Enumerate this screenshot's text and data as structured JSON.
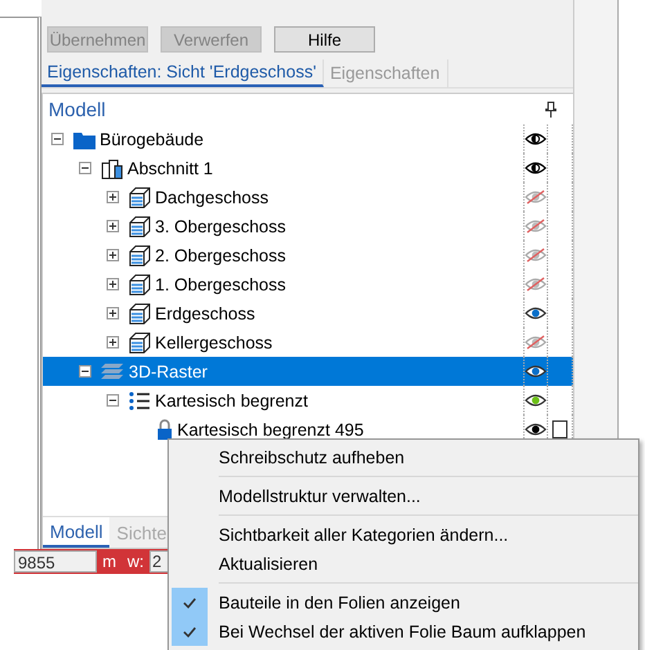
{
  "toolbar": {
    "buttons": [
      {
        "label": "Übernehmen",
        "disabled": true
      },
      {
        "label": "Verwerfen",
        "disabled": true
      },
      {
        "label": "Hilfe",
        "disabled": false
      }
    ]
  },
  "tabs": [
    {
      "label": "Eigenschaften: Sicht 'Erdgeschoss'",
      "selected": true
    },
    {
      "label": "Eigenschaften",
      "selected": false
    }
  ],
  "tree": {
    "title": "Modell",
    "nodes": [
      {
        "label": "Bürogebäude",
        "kind": "folder",
        "eye": {
          "partial": true,
          "hidden": false,
          "color": "#000000"
        },
        "selected": false,
        "expanded": true,
        "children": [
          {
            "label": "Abschnitt 1",
            "kind": "building",
            "eye": {
              "partial": true,
              "hidden": false,
              "color": "#000000"
            },
            "selected": false,
            "expanded": true,
            "children": [
              {
                "label": "Dachgeschoss",
                "kind": "floor",
                "eye": {
                  "partial": false,
                  "hidden": true,
                  "color": "#bbbbbb"
                },
                "selected": false,
                "expanded": false
              },
              {
                "label": "3. Obergeschoss",
                "kind": "floor",
                "eye": {
                  "partial": false,
                  "hidden": true,
                  "color": "#bbbbbb"
                },
                "selected": false,
                "expanded": false
              },
              {
                "label": "2. Obergeschoss",
                "kind": "floor",
                "eye": {
                  "partial": false,
                  "hidden": true,
                  "color": "#bbbbbb"
                },
                "selected": false,
                "expanded": false
              },
              {
                "label": "1. Obergeschoss",
                "kind": "floor",
                "eye": {
                  "partial": false,
                  "hidden": true,
                  "color": "#bbbbbb"
                },
                "selected": false,
                "expanded": false
              },
              {
                "label": "Erdgeschoss",
                "kind": "floor",
                "eye": {
                  "partial": false,
                  "hidden": false,
                  "color": "#0a6fc9"
                },
                "selected": false,
                "expanded": false
              },
              {
                "label": "Kellergeschoss",
                "kind": "floor",
                "eye": {
                  "partial": false,
                  "hidden": true,
                  "color": "#bbbbbb"
                },
                "selected": false,
                "expanded": false
              }
            ]
          },
          {
            "label": "3D-Raster",
            "kind": "grid",
            "eye": {
              "partial": false,
              "hidden": false,
              "color": "#0a6fc9"
            },
            "selected": true,
            "expanded": true,
            "children": [
              {
                "label": "Kartesisch begrenzt",
                "kind": "list",
                "eye": {
                  "partial": false,
                  "hidden": false,
                  "color": "#6cc017"
                },
                "selected": false,
                "expanded": true,
                "children": [
                  {
                    "label": "Kartesisch begrenzt 495",
                    "kind": "lock",
                    "eye": {
                      "partial": false,
                      "hidden": false,
                      "color": "#000000"
                    },
                    "selected": false,
                    "box": {
                      "checked": false
                    }
                  }
                ]
              }
            ]
          }
        ]
      }
    ]
  },
  "bottom_tabs": [
    {
      "label": "Modell",
      "selected": true
    },
    {
      "label": "Sichte",
      "selected": false
    }
  ],
  "status_bar": {
    "field_1": "9855",
    "unit": "m",
    "label": "w:",
    "field_2": "2"
  },
  "context_menu": {
    "items": [
      {
        "kind": "item",
        "label": "Schreibschutz aufheben",
        "checked": false
      },
      {
        "kind": "separator"
      },
      {
        "kind": "item",
        "label": "Modellstruktur verwalten...",
        "checked": false
      },
      {
        "kind": "separator"
      },
      {
        "kind": "item",
        "label": "Sichtbarkeit aller Kategorien ändern...",
        "checked": false
      },
      {
        "kind": "item",
        "label": "Aktualisieren",
        "checked": false
      },
      {
        "kind": "separator"
      },
      {
        "kind": "item",
        "label": "Bauteile in den Folien anzeigen",
        "checked": true
      },
      {
        "kind": "item",
        "label": "Bei Wechsel der aktiven Folie Baum aufklappen",
        "checked": true
      }
    ]
  }
}
